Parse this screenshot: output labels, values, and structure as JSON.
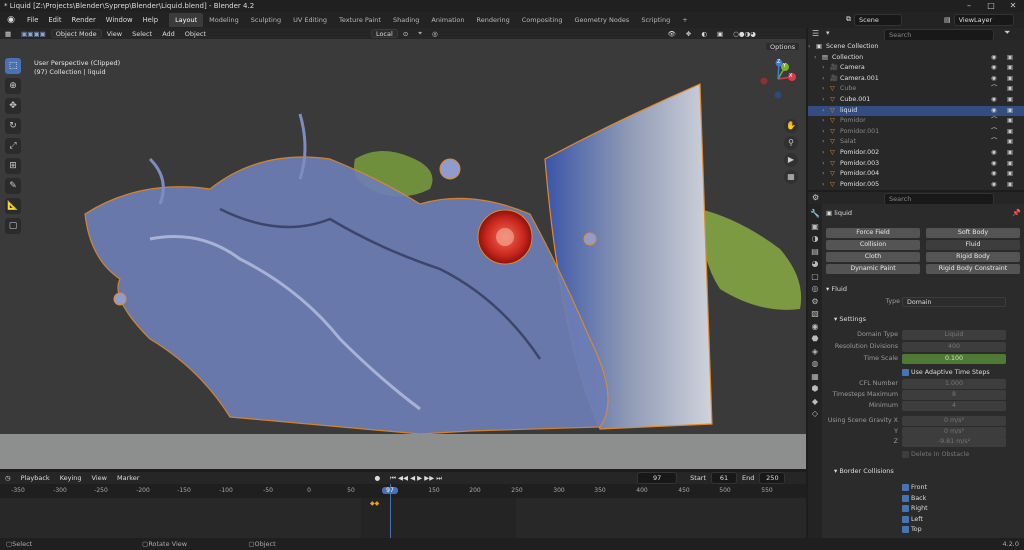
{
  "window": {
    "title": "* Liquid [Z:\\Projects\\Blender\\Syprep\\Blender\\Liquid.blend] - Blender 4.2",
    "controls": [
      "–",
      "□",
      "✕"
    ]
  },
  "menu": {
    "items": [
      "File",
      "Edit",
      "Render",
      "Window",
      "Help"
    ]
  },
  "workspaces": [
    "Layout",
    "Modeling",
    "Sculpting",
    "UV Editing",
    "Texture Paint",
    "Shading",
    "Animation",
    "Rendering",
    "Compositing",
    "Geometry Nodes",
    "Scripting",
    "+"
  ],
  "scene": {
    "label": "Scene",
    "view_layer": "ViewLayer"
  },
  "viewport": {
    "mode": "Object Mode",
    "menus": [
      "View",
      "Select",
      "Add",
      "Object"
    ],
    "transform_orientation": "Local",
    "overlay_title": "User Perspective (Clipped)",
    "overlay_subtitle": "(97) Collection | liquid",
    "options_label": "Options",
    "gizmo": {
      "x": "X",
      "y": "Y",
      "z": "Z"
    }
  },
  "timeline": {
    "menus": [
      "Playback",
      "Keying",
      "View",
      "Marker"
    ],
    "current_frame": "97",
    "start_label": "Start",
    "start": "61",
    "end_label": "End",
    "end": "250",
    "ruler": [
      "-350",
      "-300",
      "-250",
      "-200",
      "-150",
      "-100",
      "-50",
      "0",
      "50",
      "97",
      "150",
      "200",
      "250",
      "300",
      "350",
      "400",
      "450",
      "500",
      "550"
    ]
  },
  "status": {
    "items": [
      "Select",
      "Rotate View",
      "Object"
    ],
    "version": "4.2.0"
  },
  "outliner": {
    "search_placeholder": "Search",
    "rows": [
      {
        "name": "Scene Collection",
        "type": "scene",
        "selected": false,
        "dim": false
      },
      {
        "name": "Collection",
        "type": "collection",
        "selected": false,
        "dim": false
      },
      {
        "name": "Camera",
        "type": "camera",
        "selected": false,
        "dim": false
      },
      {
        "name": "Camera.001",
        "type": "camera",
        "selected": false,
        "dim": false
      },
      {
        "name": "Cube",
        "type": "mesh",
        "selected": false,
        "dim": true
      },
      {
        "name": "Cube.001",
        "type": "mesh",
        "selected": false,
        "dim": false
      },
      {
        "name": "liquid",
        "type": "mesh",
        "selected": true,
        "dim": false
      },
      {
        "name": "Pomidor",
        "type": "mesh",
        "selected": false,
        "dim": true
      },
      {
        "name": "Pomidor.001",
        "type": "mesh",
        "selected": false,
        "dim": true
      },
      {
        "name": "Salat",
        "type": "mesh",
        "selected": false,
        "dim": true
      },
      {
        "name": "Pomidor.002",
        "type": "mesh",
        "selected": false,
        "dim": false
      },
      {
        "name": "Pomidor.003",
        "type": "mesh",
        "selected": false,
        "dim": false
      },
      {
        "name": "Pomidor.004",
        "type": "mesh",
        "selected": false,
        "dim": false
      },
      {
        "name": "Pomidor.005",
        "type": "mesh",
        "selected": false,
        "dim": false
      }
    ]
  },
  "properties": {
    "search_placeholder": "Search",
    "object_name": "liquid",
    "physics_buttons": [
      "Force Field",
      "Soft Body",
      "Collision",
      "Fluid",
      "Cloth",
      "Rigid Body",
      "Dynamic Paint",
      "Rigid Body Constraint"
    ],
    "fluid_section": "Fluid",
    "type_label": "Type",
    "type_value": "Domain",
    "settings_section": "Settings",
    "fields": [
      {
        "label": "Domain Type",
        "value": "Liquid"
      },
      {
        "label": "Resolution Divisions",
        "value": "400"
      },
      {
        "label": "Time Scale",
        "value": "0.100"
      }
    ],
    "adaptive_label": "Use Adaptive Time Steps",
    "fields2": [
      {
        "label": "CFL Number",
        "value": "1.000"
      },
      {
        "label": "Timesteps Maximum",
        "value": "8"
      },
      {
        "label": "Minimum",
        "value": "4"
      }
    ],
    "gravity": [
      {
        "label": "Using Scene Gravity X",
        "value": "0 m/s²"
      },
      {
        "label": "Y",
        "value": "0 m/s²"
      },
      {
        "label": "Z",
        "value": "-9.81 m/s²"
      }
    ],
    "delete_obstacle": "Delete In Obstacle",
    "border_section": "Border Collisions",
    "borders": [
      "Front",
      "Back",
      "Right",
      "Left",
      "Top"
    ]
  }
}
